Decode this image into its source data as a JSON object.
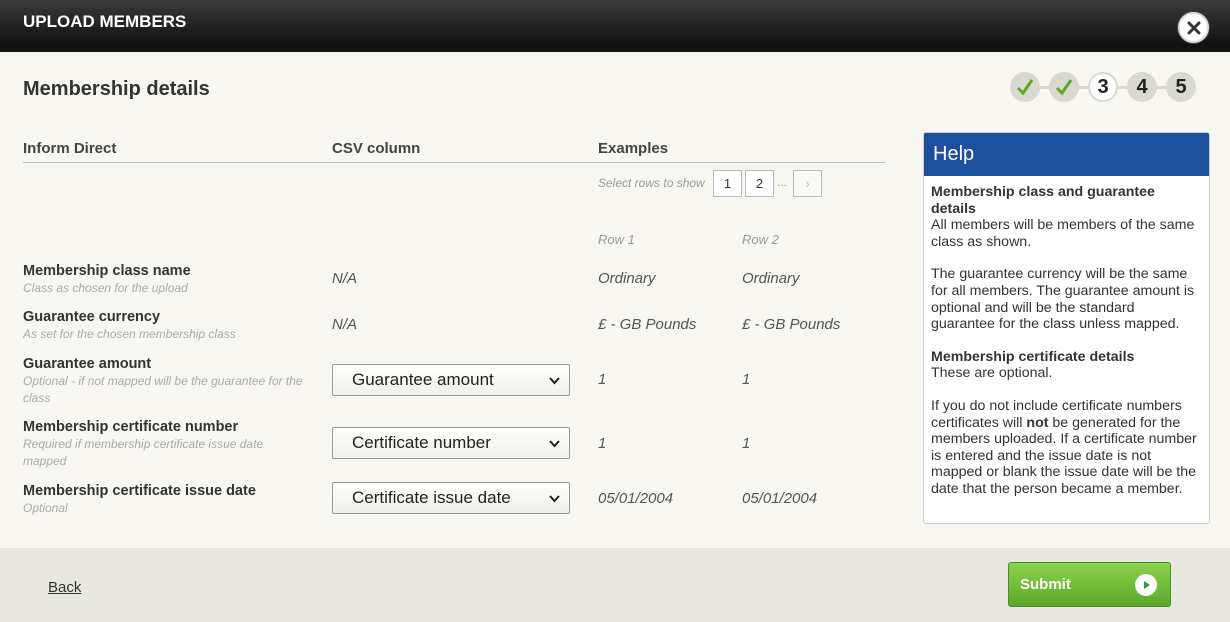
{
  "window": {
    "title": "UPLOAD MEMBERS"
  },
  "section": {
    "title": "Membership details"
  },
  "steps": [
    {
      "label": "",
      "state": "done",
      "icon": "checkmark-icon"
    },
    {
      "label": "",
      "state": "done",
      "icon": "checkmark-icon"
    },
    {
      "label": "3",
      "state": "current"
    },
    {
      "label": "4",
      "state": "upcoming"
    },
    {
      "label": "5",
      "state": "upcoming"
    }
  ],
  "table": {
    "headers": {
      "field": "Inform Direct",
      "csv": "CSV column",
      "examples": "Examples"
    },
    "select_rows_label": "Select rows to show",
    "pages": [
      "1",
      "2"
    ],
    "ellipsis": "...",
    "next": "›",
    "example_columns": [
      "Row 1",
      "Row 2"
    ],
    "rows": [
      {
        "name": "Membership class name",
        "hint": "Class as chosen for the upload",
        "csv": "N/A",
        "ex1": "Ordinary",
        "ex2": "Ordinary"
      },
      {
        "name": "Guarantee currency",
        "hint": "As set for the chosen membership class",
        "csv": "N/A",
        "ex1": "£ - GB Pounds",
        "ex2": "£ - GB Pounds"
      },
      {
        "name": "Guarantee amount",
        "hint": "Optional - if not mapped will be the guarantee for the class",
        "csv_select": "Guarantee amount",
        "ex1": "1",
        "ex2": "1"
      },
      {
        "name": "Membership certificate number",
        "hint": "Required if membership certificate issue date mapped",
        "csv_select": "Certificate number",
        "ex1": "1",
        "ex2": "1"
      },
      {
        "name": "Membership certificate issue date",
        "hint": "Optional",
        "csv_select": "Certificate issue date",
        "ex1": "05/01/2004",
        "ex2": "05/01/2004"
      }
    ]
  },
  "help": {
    "title": "Help",
    "s1_heading": "Membership class and guarantee details",
    "s1_text": "All members will be members of the same class as shown.",
    "s2_text": "The guarantee currency will be the same for all members. The guarantee amount is optional and will be the standard guarantee for the class unless mapped.",
    "s3_heading": "Membership certificate details",
    "s3_text": "These are optional.",
    "s4_pre": "If you do not include certificate numbers certificates will",
    "s4_bold": "not",
    "s4_post": "be generated for the members uploaded. If a certificate number is entered and the issue date is not mapped or blank the issue date will be the date that the person became a member."
  },
  "footer": {
    "back": "Back",
    "submit": "Submit"
  },
  "colors": {
    "help_header": "#1c4f9c",
    "submit_green": "#6bbf33",
    "check_green": "#5aa72a"
  }
}
